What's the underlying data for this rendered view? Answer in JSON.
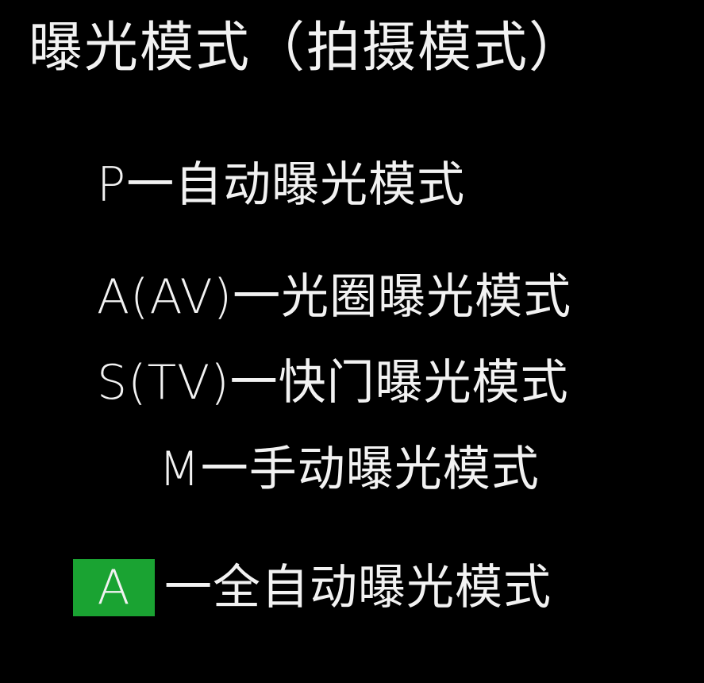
{
  "title": "曝光模式（拍摄模式）",
  "modes": [
    {
      "code": "P",
      "desc": "一自动曝光模式"
    },
    {
      "code": "A(AV)",
      "desc": "一光圈曝光模式"
    },
    {
      "code": "S(TV)",
      "desc": "一快门曝光模式"
    },
    {
      "code": "M ",
      "desc": "一手动曝光模式"
    },
    {
      "code": "A",
      "desc": "一全自动曝光模式"
    }
  ],
  "colors": {
    "background": "#000000",
    "text": "#f2f2f2",
    "badge": "#1aa332"
  }
}
